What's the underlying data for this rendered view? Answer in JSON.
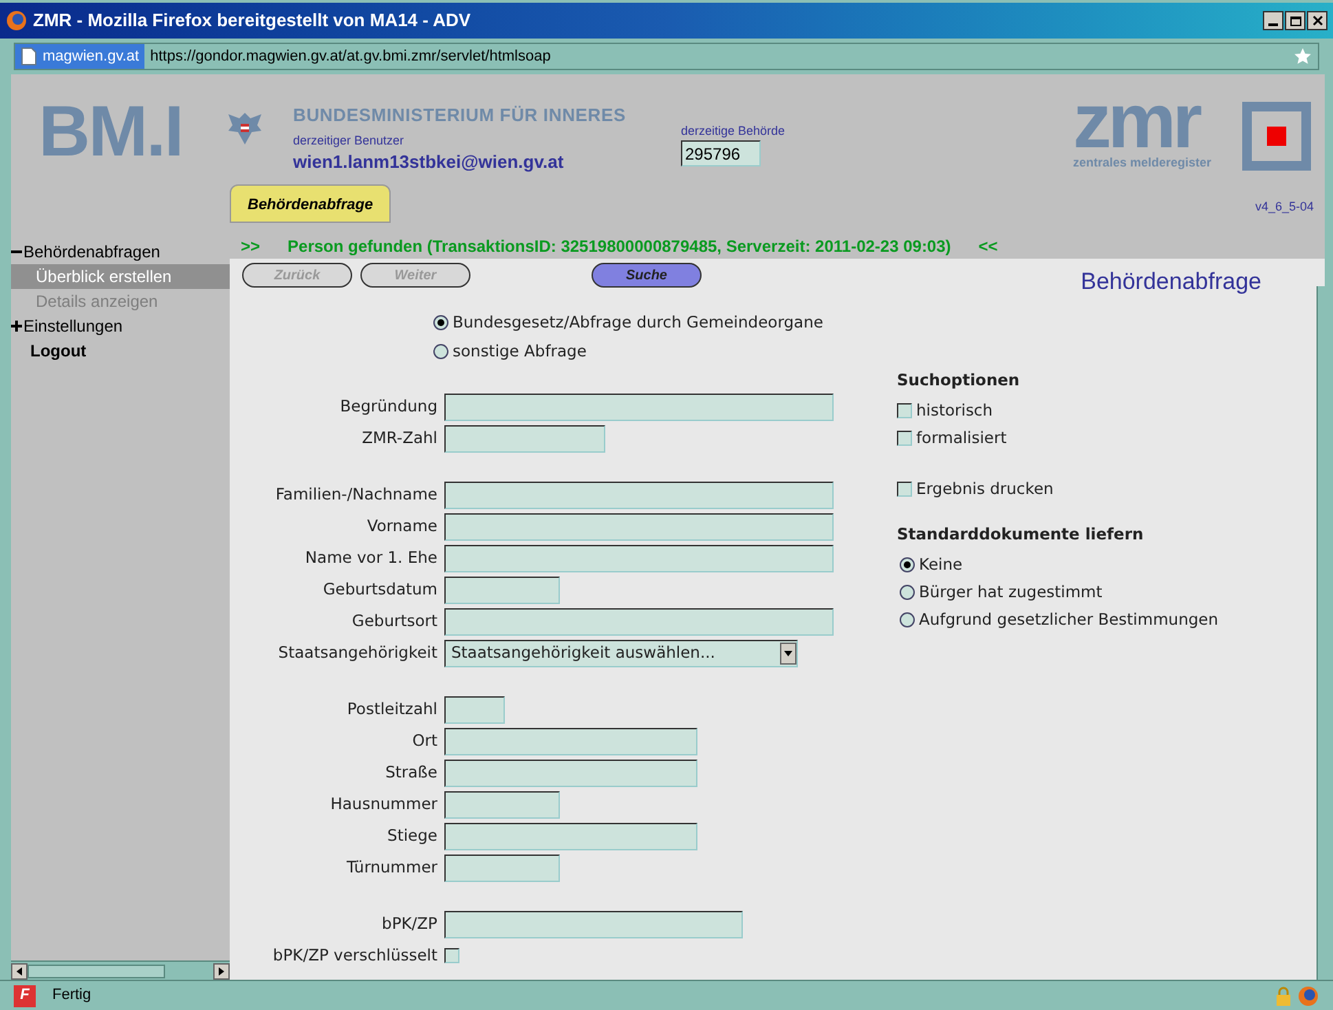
{
  "window": {
    "title": "ZMR - Mozilla Firefox bereitgestellt von MA14 - ADV"
  },
  "address_bar": {
    "site": "magwien.gv.at",
    "url": "https://gondor.magwien.gv.at/at.gv.bmi.zmr/servlet/htmlsoap"
  },
  "header": {
    "logo": "BM.I",
    "ministry": "BUNDESMINISTERIUM FÜR INNERES",
    "user_label": "derzeitiger Benutzer",
    "user": "wien1.lanm13stbkei@wien.gv.at",
    "authority_label": "derzeitige Behörde",
    "authority": "295796",
    "zmr_logo": "zmr",
    "zmr_subtitle": "zentrales melderegister",
    "version": "v4_6_5-04"
  },
  "tabs": [
    {
      "label": "Behördenabfrage",
      "selected": true
    }
  ],
  "message": {
    "prefix": ">>",
    "text": "Person gefunden (TransaktionsID: 32519800000879485, Serverzeit: 2011-02-23 09:03)",
    "suffix": "<<"
  },
  "sidebar": {
    "items": [
      {
        "label": "Behördenabfragen",
        "expanded": true,
        "children": [
          {
            "label": "Überblick erstellen",
            "selected": true,
            "disabled": false
          },
          {
            "label": "Details anzeigen",
            "selected": false,
            "disabled": true
          }
        ]
      },
      {
        "label": "Einstellungen",
        "expanded": false
      },
      {
        "label": "Logout",
        "kind": "bold"
      }
    ]
  },
  "buttons": [
    {
      "label": "Zurück",
      "disabled": true
    },
    {
      "label": "Weiter",
      "disabled": true
    },
    {
      "label": "Suche",
      "disabled": false
    }
  ],
  "page_title": "Behördenabfrage",
  "query_type": [
    {
      "label": "Bundesgesetz/Abfrage durch Gemeindeorgane",
      "selected": true
    },
    {
      "label": "sonstige Abfrage",
      "selected": false
    }
  ],
  "form_groups": [
    [
      {
        "label": "Begründung",
        "kind": "long"
      },
      {
        "label": "ZMR-Zahl",
        "kind": "medium"
      }
    ],
    [
      {
        "label": "Familien-/Nachname",
        "kind": "long"
      },
      {
        "label": "Vorname",
        "kind": "long"
      },
      {
        "label": "Name vor 1. Ehe",
        "kind": "long"
      },
      {
        "label": "Geburtsdatum",
        "kind": "short"
      },
      {
        "label": "Geburtsort",
        "kind": "long"
      },
      {
        "label": "Staatsangehörigkeit",
        "kind": "select",
        "value": "Staatsangehörigkeit auswählen..."
      }
    ],
    [
      {
        "label": "Postleitzahl",
        "kind": "tiny"
      },
      {
        "label": "Ort",
        "kind": "wide"
      },
      {
        "label": "Straße",
        "kind": "wide"
      },
      {
        "label": "Hausnummer",
        "kind": "short"
      },
      {
        "label": "Stiege",
        "kind": "wide"
      },
      {
        "label": "Türnummer",
        "kind": "short"
      }
    ],
    [
      {
        "label": "bPK/ZP",
        "kind": "bpk"
      },
      {
        "label": "bPK/ZP verschlüsselt",
        "kind": "checkbox",
        "checked": false
      }
    ]
  ],
  "search_options": {
    "title": "Suchoptionen",
    "items": [
      {
        "label": "historisch",
        "checked": false
      },
      {
        "label": "formalisiert",
        "checked": false
      }
    ],
    "print": {
      "label": "Ergebnis drucken",
      "checked": false
    }
  },
  "documents": {
    "title": "Standarddokumente liefern",
    "options": [
      {
        "label": "Keine",
        "selected": true
      },
      {
        "label": "Bürger hat zugestimmt",
        "selected": false
      },
      {
        "label": "Aufgrund gesetzlicher Bestimmungen",
        "selected": false
      }
    ]
  },
  "status_bar": {
    "flash_icon": "F",
    "text": "Fertig"
  }
}
